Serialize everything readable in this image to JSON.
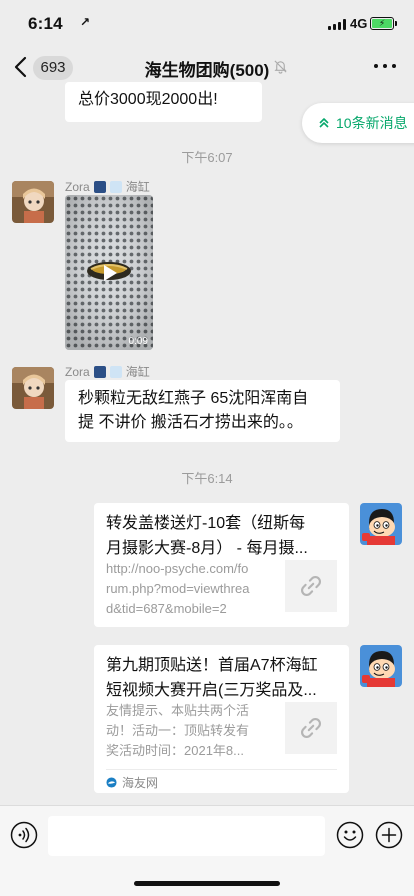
{
  "status_bar": {
    "time": "6:14",
    "location_arrow": "↗",
    "network": "4G",
    "battery_glyph": "⚡"
  },
  "nav": {
    "back_count": "693",
    "title": "海生物团购(500)"
  },
  "new_messages_label": "10条新消息",
  "messages": [
    {
      "type": "text",
      "text": "总价3000现2000出!"
    },
    {
      "type": "time",
      "text": "下午6:07"
    },
    {
      "type": "video",
      "sender": "Zora",
      "sender_tag": "海缸",
      "duration": "0:09"
    },
    {
      "type": "text",
      "sender": "Zora",
      "sender_tag": "海缸",
      "lines": [
        "秒颗粒无敌红燕子 65沈阳浑南自",
        "提 不讲价 搬活石才捞出来的。。"
      ]
    },
    {
      "type": "time",
      "text": "下午6:14"
    },
    {
      "type": "link",
      "title_lines": [
        "转发盖楼送灯-10套（纽斯每",
        "月摄影大赛-8月） - 每月摄..."
      ],
      "desc_lines": [
        "http://noo-psyche.com/fo",
        "rum.php?mod=viewthrea",
        "d&tid=687&mobile=2"
      ]
    },
    {
      "type": "link",
      "title_lines": [
        "第九期顶贴送！首届A7杯海缸",
        "短视频大赛开启(三万奖品及..."
      ],
      "desc_lines": [
        "友情提示、本贴共两个活",
        "动！活动一：顶贴转发有",
        "奖活动时间：2021年8..."
      ],
      "source": "海友网"
    }
  ],
  "icons": {
    "back": "chevron-left-icon",
    "mute": "bell-off-icon",
    "more": "more-dots-icon",
    "voice": "voice-icon",
    "emoji": "emoji-icon",
    "plus": "plus-icon",
    "link": "link-icon",
    "play": "play-icon"
  },
  "colors": {
    "accent_green": "#07a86c",
    "battery_green": "#4cd964",
    "chat_bg": "#ededed"
  }
}
